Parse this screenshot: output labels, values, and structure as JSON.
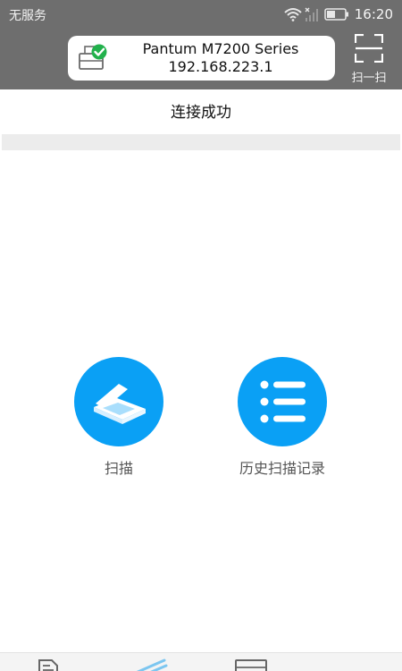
{
  "status_bar": {
    "carrier": "无服务",
    "time": "16:20"
  },
  "printer": {
    "name": "Pantum M7200 Series",
    "ip": "192.168.223.1"
  },
  "header": {
    "scan_qr_label": "扫一扫"
  },
  "connection": {
    "status_text": "连接成功"
  },
  "actions": {
    "scan_label": "扫描",
    "history_label": "历史扫描记录"
  },
  "colors": {
    "header_bg": "#6e6e6e",
    "accent": "#0aa0f5",
    "connected_green": "#22b14c",
    "nav_active": "#7cc6f0"
  },
  "icons": {
    "printer": "printer-connected-icon",
    "scan_frame": "qr-scan-frame-icon",
    "scanner": "flatbed-scanner-icon",
    "history": "list-icon"
  }
}
